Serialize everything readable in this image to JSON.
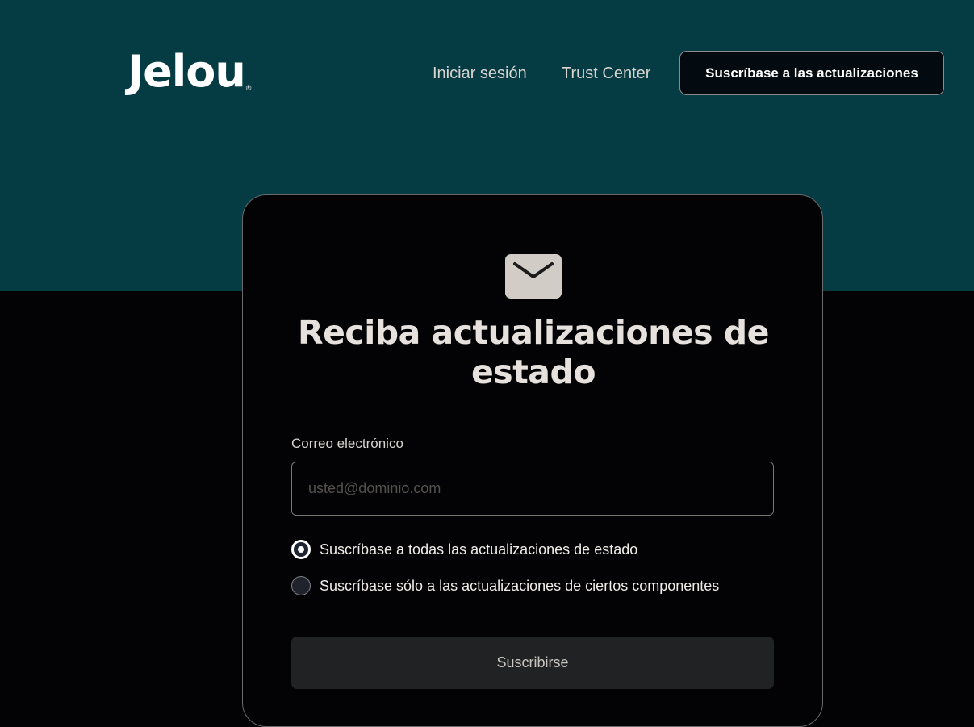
{
  "header": {
    "logo_text": "Jelou",
    "logo_mark": "®",
    "nav": {
      "login_label": "Iniciar sesión",
      "trust_label": "Trust Center"
    },
    "subscribe_button_label": "Suscríbase a las actualizaciones"
  },
  "card": {
    "icon": "envelope-icon",
    "title": "Reciba actualizaciones de estado",
    "email": {
      "label": "Correo electrónico",
      "placeholder": "usted@dominio.com",
      "value": ""
    },
    "options": [
      {
        "label": "Suscríbase a todas las actualizaciones de estado",
        "selected": true
      },
      {
        "label": "Suscríbase sólo a las actualizaciones de ciertos componentes",
        "selected": false
      }
    ],
    "submit_label": "Suscribirse"
  },
  "colors": {
    "header_background": "#053b43",
    "page_background": "#030305",
    "text_primary": "#e6e1dc",
    "button_dark": "#212224"
  }
}
